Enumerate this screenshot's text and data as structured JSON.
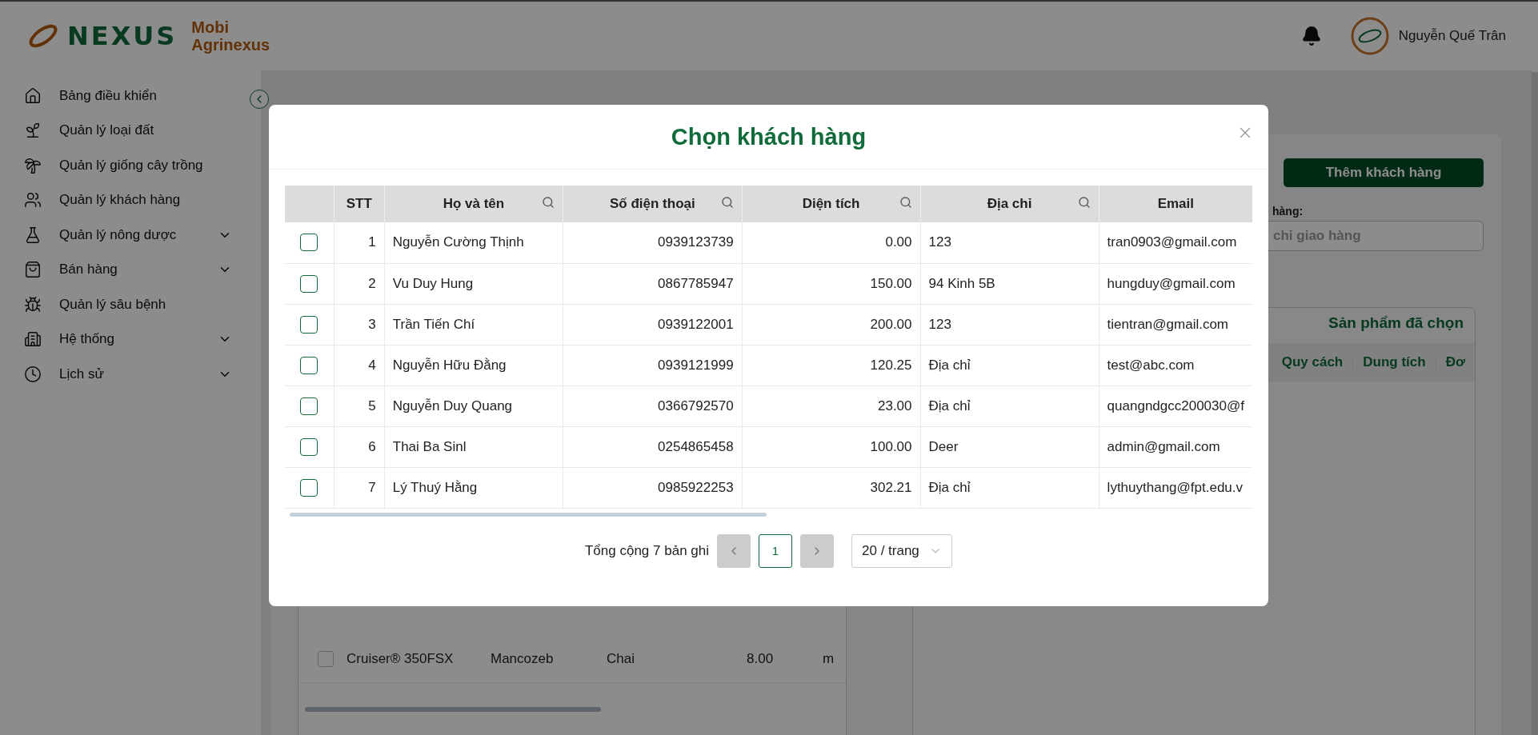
{
  "header": {
    "logo_text": "NEXUS",
    "brand_line1": "Mobi",
    "brand_line2": "Agrinexus",
    "user_name": "Nguyễn Quế Trân"
  },
  "sidebar": {
    "items": [
      {
        "label": "Bảng điều khiển",
        "has_children": false
      },
      {
        "label": "Quản lý loại đất",
        "has_children": false
      },
      {
        "label": "Quản lý giống cây trồng",
        "has_children": false
      },
      {
        "label": "Quản lý khách hàng",
        "has_children": false
      },
      {
        "label": "Quản lý nông dược",
        "has_children": true
      },
      {
        "label": "Bán hàng",
        "has_children": true
      },
      {
        "label": "Quản lý sâu bệnh",
        "has_children": false
      },
      {
        "label": "Hệ thống",
        "has_children": true
      },
      {
        "label": "Lịch sử",
        "has_children": true
      }
    ]
  },
  "page": {
    "add_customer_button": "Thêm khách hàng",
    "address_label": "hàng:",
    "address_placeholder": "chỉ giao hàng",
    "selected_products": {
      "title": "Sản phẩm đã chọn",
      "columns": [
        "Quy cách",
        "Dung tích",
        "Đơ"
      ]
    },
    "products": {
      "rows": [
        {
          "checked": false,
          "cells": [
            "Cruiser® 350FSX",
            "Mancozeb",
            "Chai",
            "8.00",
            "m"
          ]
        }
      ]
    }
  },
  "modal": {
    "title": "Chọn khách hàng",
    "columns": [
      {
        "label": "STT",
        "searchable": false
      },
      {
        "label": "Họ và tên",
        "searchable": true
      },
      {
        "label": "Số điện thoại",
        "searchable": true
      },
      {
        "label": "Diện tích",
        "searchable": true
      },
      {
        "label": "Địa chỉ",
        "searchable": true
      },
      {
        "label": "Email",
        "searchable": false
      }
    ],
    "rows": [
      {
        "checked": false,
        "cells": [
          "1",
          "Nguyễn Cường Thịnh",
          "0939123739",
          "0.00",
          "123",
          "tran0903@gmail.com"
        ]
      },
      {
        "checked": false,
        "cells": [
          "2",
          "Vu Duy Hung",
          "0867785947",
          "150.00",
          "94 Kinh 5B",
          "hungduy@gmail.com"
        ]
      },
      {
        "checked": false,
        "cells": [
          "3",
          "Trần Tiến Chí",
          "0939122001",
          "200.00",
          "123",
          "tientran@gmail.com"
        ]
      },
      {
        "checked": false,
        "cells": [
          "4",
          "Nguyễn Hữu Đằng",
          "0939121999",
          "120.25",
          "Địa chỉ",
          "test@abc.com"
        ]
      },
      {
        "checked": false,
        "cells": [
          "5",
          "Nguyễn Duy Quang",
          "0366792570",
          "23.00",
          "Địa chỉ",
          "quangndgcc200030@f"
        ]
      },
      {
        "checked": false,
        "cells": [
          "6",
          "Thai Ba Sinl",
          "0254865458",
          "100.00",
          "Deer",
          "admin@gmail.com"
        ]
      },
      {
        "checked": false,
        "cells": [
          "7",
          "Lý Thuý Hằng",
          "0985922253",
          "302.21",
          "Địa chỉ",
          "lythuythang@fpt.edu.v"
        ]
      }
    ],
    "pagination": {
      "total": "Tổng cộng 7 bản ghi",
      "pages": [
        {
          "label": "1",
          "selected": true
        }
      ],
      "page_size": "20 / trang"
    }
  }
}
